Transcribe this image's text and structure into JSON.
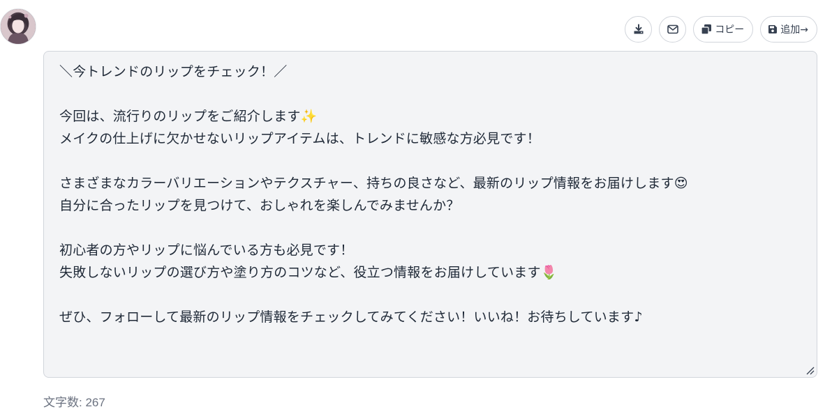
{
  "toolbar": {
    "download_icon": "download-icon",
    "mail_icon": "mail-icon",
    "copy_icon": "copy-icon",
    "copy_label": "コピー",
    "save_icon": "save-icon",
    "add_label": "追加→"
  },
  "post": {
    "lines": [
      "＼今トレンドのリップをチェック！／",
      "",
      "今回は、流行りのリップをご紹介します✨",
      "メイクの仕上げに欠かせないリップアイテムは、トレンドに敏感な方必見です！",
      "",
      "さまざまなカラーバリエーションやテクスチャー、持ちの良さなど、最新のリップ情報をお届けします😍",
      "自分に合ったリップを見つけて、おしゃれを楽しんでみませんか？",
      "",
      "初心者の方やリップに悩んでいる方も必見です！",
      "失敗しないリップの選び方や塗り方のコツなど、役立つ情報をお届けしています🌷",
      "",
      "ぜひ、フォローして最新のリップ情報をチェックしてみてください！いいね！お待ちしています♪"
    ]
  },
  "footer": {
    "char_count": "文字数: 267"
  },
  "colors": {
    "editor_bg": "#f3f4f6",
    "border": "#d1d5db",
    "muted_text": "#6b7280"
  }
}
